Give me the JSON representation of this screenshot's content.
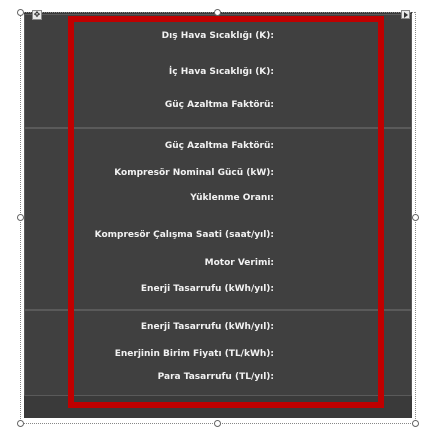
{
  "form": {
    "labels": [
      "Dış Hava Sıcaklığı (K):",
      "İç Hava Sıcaklığı (K):",
      "Güç Azaltma Faktörü:",
      "Güç Azaltma Faktörü:",
      "Kompresör Nominal Gücü (kW):",
      "Yüklenme Oranı:",
      "Kompresör Çalışma Saati (saat/yıl):",
      "Motor Verimi:",
      "Enerji Tasarrufu (kWh/yıl):",
      "Enerji Tasarrufu (kWh/yıl):",
      "Enerjinin Birim Fiyatı (TL/kWh):",
      "Para Tasarrufu (TL/yıl):"
    ]
  },
  "colors": {
    "highlight_frame": "#c00000",
    "panel_background": "#404040"
  },
  "icons": {
    "move_handle": "move-icon",
    "smart_tag": "expand-arrow-icon"
  }
}
